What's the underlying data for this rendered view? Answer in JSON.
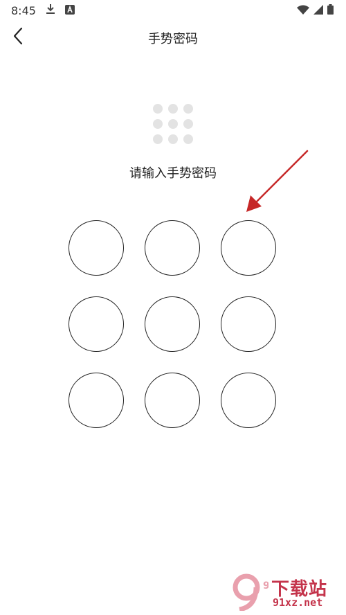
{
  "status_bar": {
    "time": "8:45",
    "icons": [
      "download-icon",
      "a-badge-icon",
      "wifi-icon",
      "signal-icon",
      "battery-icon"
    ]
  },
  "header": {
    "title": "手势密码",
    "back_icon": "chevron-left-icon"
  },
  "main": {
    "prompt": "请输入手势密码",
    "indicator_dots": 9,
    "gesture_nodes": 9
  },
  "watermark": {
    "logo": "9",
    "text_top": "下载站",
    "text_bottom": "91xz.net"
  },
  "colors": {
    "background": "#ffffff",
    "text": "#222222",
    "indicator_dot": "#e3e3e3",
    "node_border": "#222222",
    "annotation_arrow": "#c62828",
    "watermark": "#c4344b"
  }
}
